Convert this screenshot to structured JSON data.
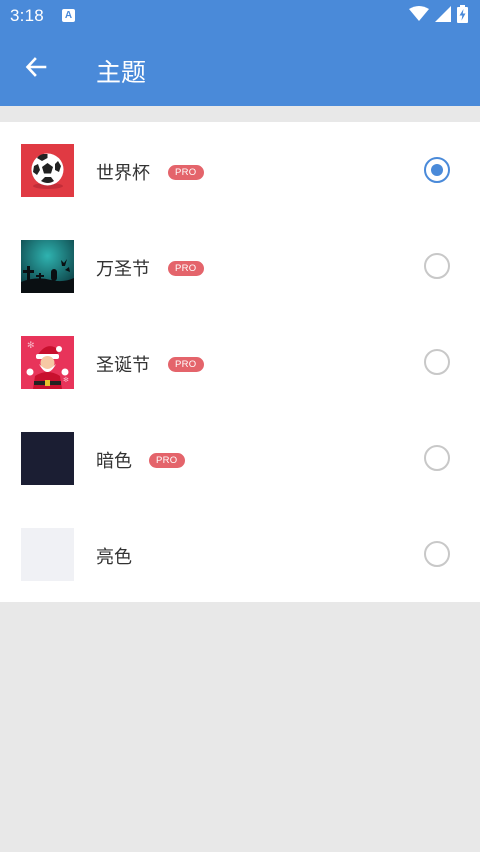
{
  "status_bar": {
    "time": "3:18",
    "notification_icon": "a-notification-icon",
    "icons": [
      "wifi-icon",
      "cell-signal-icon",
      "battery-charging-icon"
    ]
  },
  "app_bar": {
    "back_icon": "arrow-left-icon",
    "title": "主题"
  },
  "themes": [
    {
      "label": "世界杯",
      "badge": "PRO",
      "thumbnail": "soccer-ball",
      "selected": true
    },
    {
      "label": "万圣节",
      "badge": "PRO",
      "thumbnail": "halloween-graveyard",
      "selected": false
    },
    {
      "label": "圣诞节",
      "badge": "PRO",
      "thumbnail": "santa-claus",
      "selected": false
    },
    {
      "label": "暗色",
      "badge": "PRO",
      "thumbnail": "dark-swatch",
      "selected": false
    },
    {
      "label": "亮色",
      "badge": "",
      "thumbnail": "light-swatch",
      "selected": false
    }
  ],
  "colors": {
    "primary": "#4a8ad9",
    "pro_badge": "#e4646b",
    "soccer_bg": "#e03a43",
    "santa_bg": "#e8345a",
    "dark_swatch": "#1b1e33",
    "light_swatch": "#f0f1f5"
  }
}
